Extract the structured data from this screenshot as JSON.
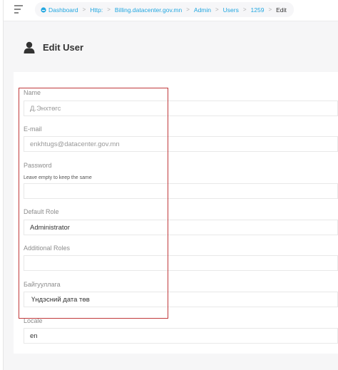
{
  "breadcrumb": {
    "items": [
      {
        "label": "Dashboard"
      },
      {
        "label": "Http:"
      },
      {
        "label": "Billing.datacenter.gov.mn"
      },
      {
        "label": "Admin"
      },
      {
        "label": "Users"
      },
      {
        "label": "1259"
      },
      {
        "label": "Edit"
      }
    ]
  },
  "header": {
    "title": "Edit User",
    "icon": "user-icon"
  },
  "form": {
    "name": {
      "label": "Name",
      "value": "Д.Энхтөгс"
    },
    "email": {
      "label": "E-mail",
      "value": "enkhtugs@datacenter.gov.mn"
    },
    "password": {
      "label": "Password",
      "hint": "Leave empty to keep the same",
      "value": ""
    },
    "default_role": {
      "label": "Default Role",
      "value": "Administrator"
    },
    "additional_roles": {
      "label": "Additional Roles",
      "value": ""
    },
    "organization": {
      "label": "Байгууллага",
      "value": "Үндэсний дата төв"
    },
    "locale": {
      "label": "Locale",
      "value": "en"
    }
  },
  "colors": {
    "link": "#22a7e0",
    "highlight_box": "#c0393b"
  }
}
